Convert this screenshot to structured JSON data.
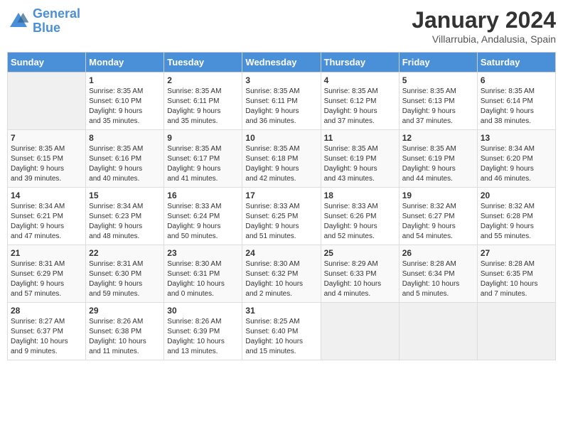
{
  "header": {
    "logo": {
      "line1": "General",
      "line2": "Blue"
    },
    "title": "January 2024",
    "subtitle": "Villarrubia, Andalusia, Spain"
  },
  "calendar": {
    "days_of_week": [
      "Sunday",
      "Monday",
      "Tuesday",
      "Wednesday",
      "Thursday",
      "Friday",
      "Saturday"
    ],
    "weeks": [
      [
        {
          "day": "",
          "info": ""
        },
        {
          "day": "1",
          "info": "Sunrise: 8:35 AM\nSunset: 6:10 PM\nDaylight: 9 hours\nand 35 minutes."
        },
        {
          "day": "2",
          "info": "Sunrise: 8:35 AM\nSunset: 6:11 PM\nDaylight: 9 hours\nand 35 minutes."
        },
        {
          "day": "3",
          "info": "Sunrise: 8:35 AM\nSunset: 6:11 PM\nDaylight: 9 hours\nand 36 minutes."
        },
        {
          "day": "4",
          "info": "Sunrise: 8:35 AM\nSunset: 6:12 PM\nDaylight: 9 hours\nand 37 minutes."
        },
        {
          "day": "5",
          "info": "Sunrise: 8:35 AM\nSunset: 6:13 PM\nDaylight: 9 hours\nand 37 minutes."
        },
        {
          "day": "6",
          "info": "Sunrise: 8:35 AM\nSunset: 6:14 PM\nDaylight: 9 hours\nand 38 minutes."
        }
      ],
      [
        {
          "day": "7",
          "info": "Sunrise: 8:35 AM\nSunset: 6:15 PM\nDaylight: 9 hours\nand 39 minutes."
        },
        {
          "day": "8",
          "info": "Sunrise: 8:35 AM\nSunset: 6:16 PM\nDaylight: 9 hours\nand 40 minutes."
        },
        {
          "day": "9",
          "info": "Sunrise: 8:35 AM\nSunset: 6:17 PM\nDaylight: 9 hours\nand 41 minutes."
        },
        {
          "day": "10",
          "info": "Sunrise: 8:35 AM\nSunset: 6:18 PM\nDaylight: 9 hours\nand 42 minutes."
        },
        {
          "day": "11",
          "info": "Sunrise: 8:35 AM\nSunset: 6:19 PM\nDaylight: 9 hours\nand 43 minutes."
        },
        {
          "day": "12",
          "info": "Sunrise: 8:35 AM\nSunset: 6:19 PM\nDaylight: 9 hours\nand 44 minutes."
        },
        {
          "day": "13",
          "info": "Sunrise: 8:34 AM\nSunset: 6:20 PM\nDaylight: 9 hours\nand 46 minutes."
        }
      ],
      [
        {
          "day": "14",
          "info": "Sunrise: 8:34 AM\nSunset: 6:21 PM\nDaylight: 9 hours\nand 47 minutes."
        },
        {
          "day": "15",
          "info": "Sunrise: 8:34 AM\nSunset: 6:23 PM\nDaylight: 9 hours\nand 48 minutes."
        },
        {
          "day": "16",
          "info": "Sunrise: 8:33 AM\nSunset: 6:24 PM\nDaylight: 9 hours\nand 50 minutes."
        },
        {
          "day": "17",
          "info": "Sunrise: 8:33 AM\nSunset: 6:25 PM\nDaylight: 9 hours\nand 51 minutes."
        },
        {
          "day": "18",
          "info": "Sunrise: 8:33 AM\nSunset: 6:26 PM\nDaylight: 9 hours\nand 52 minutes."
        },
        {
          "day": "19",
          "info": "Sunrise: 8:32 AM\nSunset: 6:27 PM\nDaylight: 9 hours\nand 54 minutes."
        },
        {
          "day": "20",
          "info": "Sunrise: 8:32 AM\nSunset: 6:28 PM\nDaylight: 9 hours\nand 55 minutes."
        }
      ],
      [
        {
          "day": "21",
          "info": "Sunrise: 8:31 AM\nSunset: 6:29 PM\nDaylight: 9 hours\nand 57 minutes."
        },
        {
          "day": "22",
          "info": "Sunrise: 8:31 AM\nSunset: 6:30 PM\nDaylight: 9 hours\nand 59 minutes."
        },
        {
          "day": "23",
          "info": "Sunrise: 8:30 AM\nSunset: 6:31 PM\nDaylight: 10 hours\nand 0 minutes."
        },
        {
          "day": "24",
          "info": "Sunrise: 8:30 AM\nSunset: 6:32 PM\nDaylight: 10 hours\nand 2 minutes."
        },
        {
          "day": "25",
          "info": "Sunrise: 8:29 AM\nSunset: 6:33 PM\nDaylight: 10 hours\nand 4 minutes."
        },
        {
          "day": "26",
          "info": "Sunrise: 8:28 AM\nSunset: 6:34 PM\nDaylight: 10 hours\nand 5 minutes."
        },
        {
          "day": "27",
          "info": "Sunrise: 8:28 AM\nSunset: 6:35 PM\nDaylight: 10 hours\nand 7 minutes."
        }
      ],
      [
        {
          "day": "28",
          "info": "Sunrise: 8:27 AM\nSunset: 6:37 PM\nDaylight: 10 hours\nand 9 minutes."
        },
        {
          "day": "29",
          "info": "Sunrise: 8:26 AM\nSunset: 6:38 PM\nDaylight: 10 hours\nand 11 minutes."
        },
        {
          "day": "30",
          "info": "Sunrise: 8:26 AM\nSunset: 6:39 PM\nDaylight: 10 hours\nand 13 minutes."
        },
        {
          "day": "31",
          "info": "Sunrise: 8:25 AM\nSunset: 6:40 PM\nDaylight: 10 hours\nand 15 minutes."
        },
        {
          "day": "",
          "info": ""
        },
        {
          "day": "",
          "info": ""
        },
        {
          "day": "",
          "info": ""
        }
      ]
    ]
  }
}
